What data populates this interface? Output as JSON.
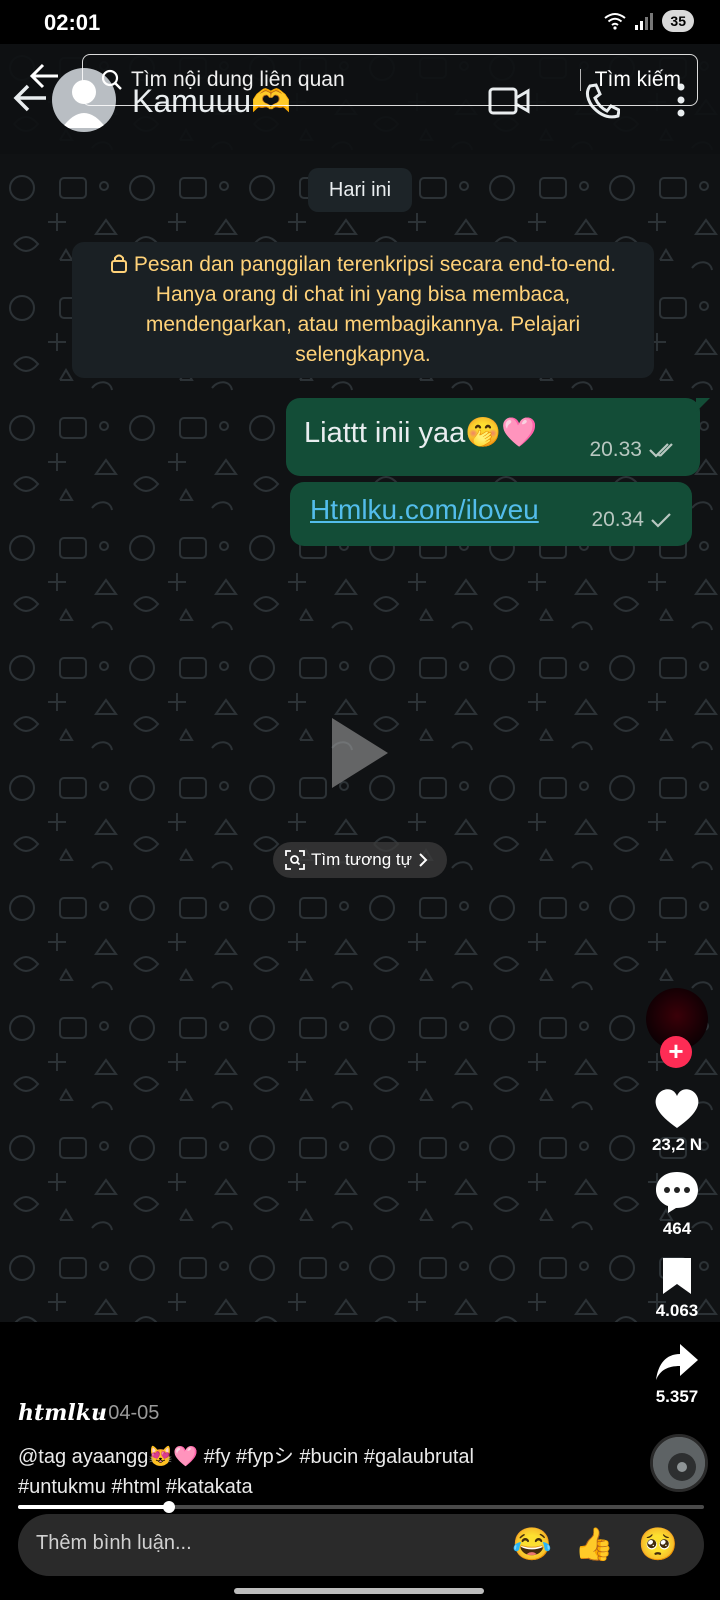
{
  "status_bar": {
    "time": "02:01",
    "battery": "35"
  },
  "whatsapp": {
    "contact_name": "Kamuuu",
    "contact_emoji": "🫶",
    "date_chip": "Hari ini",
    "encryption_notice": "Pesan dan panggilan terenkripsi secara end-to-end. Hanya orang di chat ini yang bisa membaca, mendengarkan, atau membagikannya. Pelajari selengkapnya.",
    "messages": [
      {
        "text": "Liattt inii yaa🤭🩷",
        "time": "20.33",
        "status": "read"
      },
      {
        "text": "Htmlku.com/iloveu",
        "time": "20.34",
        "status": "sent"
      }
    ]
  },
  "search": {
    "placeholder": "Tìm nội dung liên quan",
    "button": "Tìm kiếm"
  },
  "similar_chip": "Tìm tương tự",
  "rail": {
    "likes": "23,2 N",
    "comments": "464",
    "saves": "4.063",
    "shares": "5.357"
  },
  "caption": {
    "username": "htmlku",
    "date": "· 04-05",
    "line1": "@tag ayaangg😻🩷 #fy #fypシ #bucin #galaubrutal",
    "line2": "#untukmu #html #katakata"
  },
  "progress": 0.22,
  "comment": {
    "placeholder": "Thêm bình luận...",
    "emojis": [
      "😂",
      "👍",
      "🥺"
    ]
  },
  "colors": {
    "bubble": "#134d37",
    "link": "#53bdeb",
    "follow": "#fe2c55",
    "notice_text": "#ffd279"
  }
}
